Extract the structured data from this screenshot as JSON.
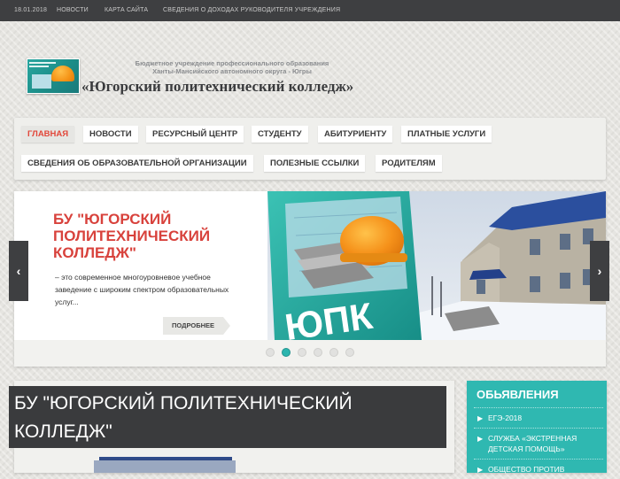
{
  "topbar": {
    "date": "18.01.2018",
    "links": [
      "Новости",
      "Карта сайта",
      "Сведения о доходах руководителя учреждения"
    ]
  },
  "header": {
    "subtitle_line1": "Бюджетное учреждение профессионального образования",
    "subtitle_line2": "Ханты-Мансийского автономного округа - Югры",
    "title": "«Югорский политехнический колледж»"
  },
  "nav": {
    "items": [
      "Главная",
      "Новости",
      "Ресурсный центр",
      "Студенту",
      "Абитуриенту",
      "Платные услуги",
      "Сведения об образовательной организации",
      "Полезные ссылки",
      "Родителям"
    ],
    "active_index": 0
  },
  "slider": {
    "title": "БУ \"Югорский политехнический колледж\"",
    "description": "– это современное многоуровневое учебное заведение с широким спектром образовательных услуг...",
    "more_label": "Подробнее",
    "prev_arrow": "‹",
    "next_arrow": "›",
    "image_text": "ЮПК",
    "dots_count": 6,
    "active_dot": 1
  },
  "content": {
    "title": "БУ \"Югорский политехнический колледж\""
  },
  "sidebar": {
    "title": "Обьявления",
    "bullet": "▶",
    "items": [
      "ЕГЭ-2018",
      "Служба «Экстренная детская помощь»",
      "Общество против"
    ]
  },
  "colors": {
    "accent_red": "#d8423c",
    "teal": "#2fb8b1",
    "dark": "#3e3f41"
  }
}
